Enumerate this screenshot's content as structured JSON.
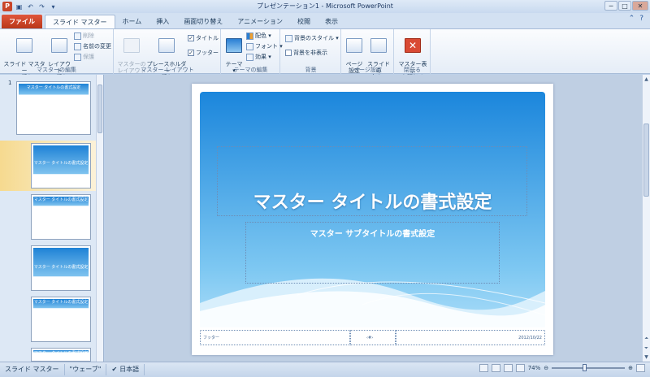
{
  "window": {
    "title": "プレゼンテーション1 - Microsoft PowerPoint",
    "min_label": "─",
    "max_label": "□",
    "close_label": "✕"
  },
  "qat": {
    "app_icon": "P",
    "save_icon": "▣",
    "undo_icon": "↶",
    "redo_icon": "↷",
    "customize_icon": "▾"
  },
  "tabs": {
    "file": "ファイル",
    "slide_master": "スライド マスター",
    "home": "ホーム",
    "insert": "挿入",
    "transitions": "画面切り替え",
    "animations": "アニメーション",
    "review": "校閲",
    "view": "表示"
  },
  "ribbon": {
    "edit_master": {
      "insert_master": "スライド マスター\nの挿入",
      "insert_layout": "レイアウト\nの挿入",
      "delete": "削除",
      "rename": "名前の変更",
      "preserve": "保護",
      "label": "マスターの編集"
    },
    "master_layout": {
      "master_layout_btn": "マスターの\nレイアウト",
      "insert_placeholder": "プレースホルダー\nの挿入 ▾",
      "title": "タイトル",
      "footer": "フッター",
      "label": "マスター レイアウト"
    },
    "edit_theme": {
      "themes": "テーマ\n▾",
      "colors": "配色 ▾",
      "fonts": "フォント ▾",
      "effects": "効果 ▾",
      "label": "テーマの編集"
    },
    "background": {
      "styles": "背景のスタイル ▾",
      "hide": "背景を非表示",
      "label": "背景"
    },
    "page_setup": {
      "setup": "ページ\n設定",
      "orientation": "スライドの\n向き ▾",
      "label": "ページ設定"
    },
    "close": {
      "close_master": "マスター表示\nを閉じる",
      "label": "閉じる"
    }
  },
  "thumbnails": {
    "master_number": "1",
    "master_title": "マスター タイトルの書式設定",
    "layout_titles": [
      "マスター タイトルの書式設定",
      "マスター タイトルの書式設定",
      "マスター タイトルの書式設定",
      "マスター タイトルの書式設定",
      "マスター タイトルの書式設定"
    ]
  },
  "slide": {
    "title": "マスター タイトルの書式設定",
    "subtitle": "マスター サブタイトルの書式設定",
    "footer": "フッター",
    "slide_number": "‹#›",
    "date": "2012/10/22"
  },
  "status": {
    "view": "スライド マスター",
    "theme": "\"ウェーブ\"",
    "language": "日本語",
    "zoom": "74%",
    "zoom_minus": "⊖",
    "zoom_plus": "⊕",
    "zoom_fraction": 0.45
  }
}
